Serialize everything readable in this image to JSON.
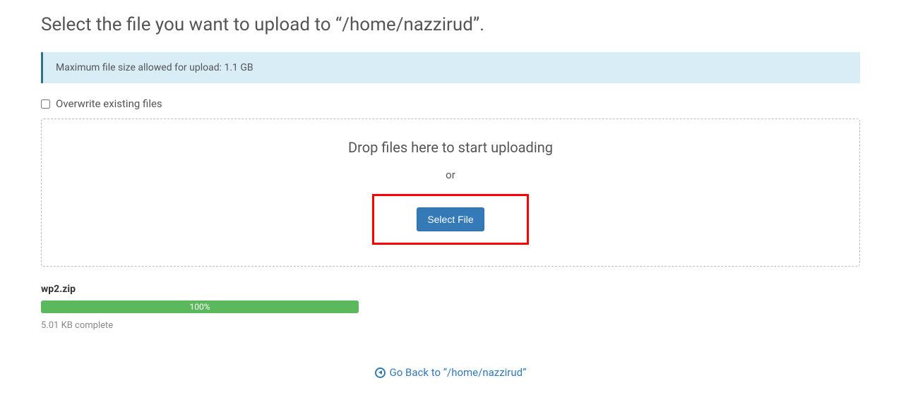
{
  "header": {
    "title": "Select the file you want to upload to “/home/nazzirud”."
  },
  "info": {
    "message": "Maximum file size allowed for upload: 1.1 GB"
  },
  "overwrite": {
    "label": "Overwrite existing files",
    "checked": false
  },
  "dropzone": {
    "headline": "Drop files here to start uploading",
    "or_text": "or",
    "button_label": "Select File"
  },
  "upload": {
    "filename": "wp2.zip",
    "percent_label": "100%",
    "percent_value": 100,
    "status": "5.01 KB complete"
  },
  "footer": {
    "go_back_label": "Go Back to “/home/nazzirud”"
  }
}
